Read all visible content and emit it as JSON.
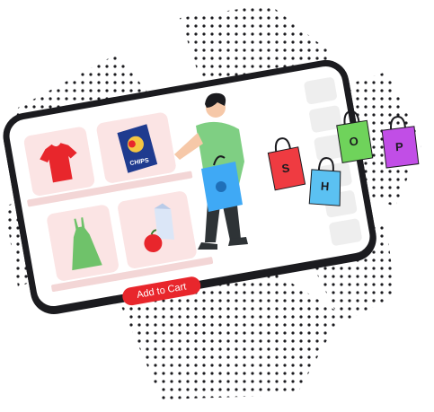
{
  "product_card": {
    "chips_label": "CHIPS"
  },
  "cart_button": {
    "label": "Add to Cart"
  },
  "shop_bags": [
    {
      "letter": "S",
      "color": "#ef3b41"
    },
    {
      "letter": "H",
      "color": "#5bc1f2"
    },
    {
      "letter": "O",
      "color": "#6fd35b"
    },
    {
      "letter": "P",
      "color": "#c14ee6"
    }
  ],
  "colors": {
    "frame": "#1b1b1f",
    "shelf": "#f3d6d6",
    "card_bg": "#fbe4e4",
    "shirt": "#e8262c",
    "dress": "#6fc26a",
    "person_shirt": "#7fcf83",
    "person_bag": "#3fa9f5",
    "cart_button": "#e8262c"
  },
  "icons": [
    "tshirt-icon",
    "chips-bag-icon",
    "dress-icon",
    "grocery-icon",
    "shopper-figure",
    "shopping-bag-icon"
  ]
}
